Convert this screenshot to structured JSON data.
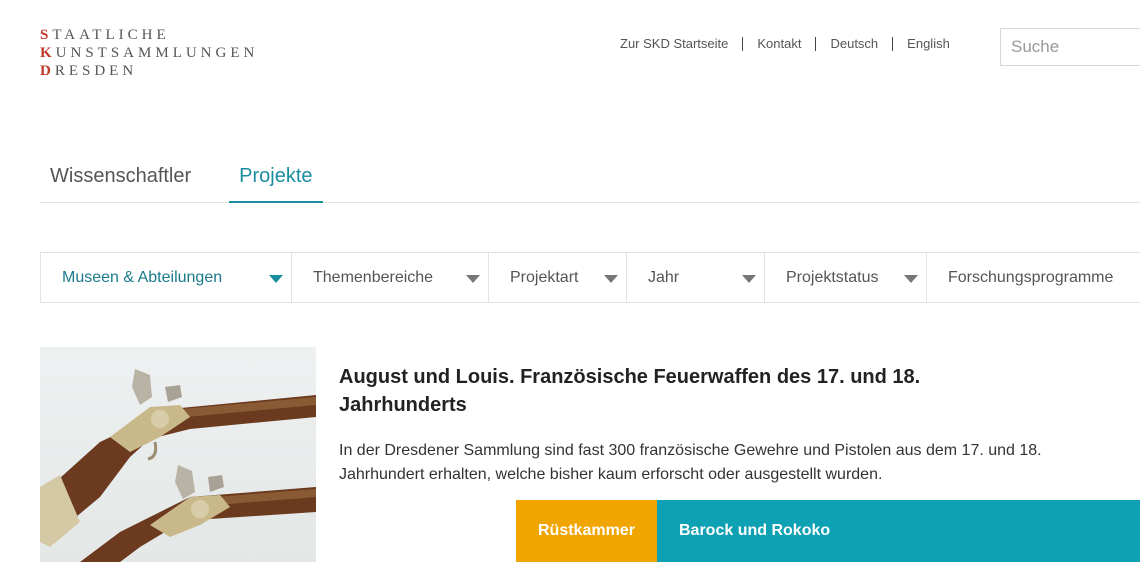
{
  "logo": {
    "lines": [
      {
        "cap": "S",
        "rest": "TAATLICHE"
      },
      {
        "cap": "K",
        "rest": "UNSTSAMMLUNGEN"
      },
      {
        "cap": "D",
        "rest": "RESDEN"
      }
    ],
    "accent_color": "#c0392b"
  },
  "topnav": {
    "items": [
      "Zur SKD Startseite",
      "Kontakt",
      "Deutsch",
      "English"
    ]
  },
  "search": {
    "placeholder": "Suche"
  },
  "tabs": [
    {
      "label": "Wissenschaftler",
      "active": false
    },
    {
      "label": "Projekte",
      "active": true
    }
  ],
  "filters": [
    {
      "label": "Museen & Abteilungen",
      "active": true
    },
    {
      "label": "Themenbereiche",
      "active": false
    },
    {
      "label": "Projektart",
      "active": false
    },
    {
      "label": "Jahr",
      "active": false
    },
    {
      "label": "Projektstatus",
      "active": false
    },
    {
      "label": "Forschungsprogramme",
      "active": false
    }
  ],
  "project": {
    "title": "August und Louis. Französische Feuerwaffen des 17. und 18. Jahrhunderts",
    "description": "In der Dresdener Sammlung sind fast 300 französische Gewehre und Pistolen aus dem 17. und 18. Jahrhundert erhalten, welche bisher kaum erforscht oder ausgestellt wurden.",
    "tags": [
      "Rüstkammer",
      "Barock und Rokoko"
    ]
  },
  "colors": {
    "accent": "#1a8ea0",
    "tag_orange": "#f0a500",
    "tag_teal": "#0ea0b3"
  }
}
